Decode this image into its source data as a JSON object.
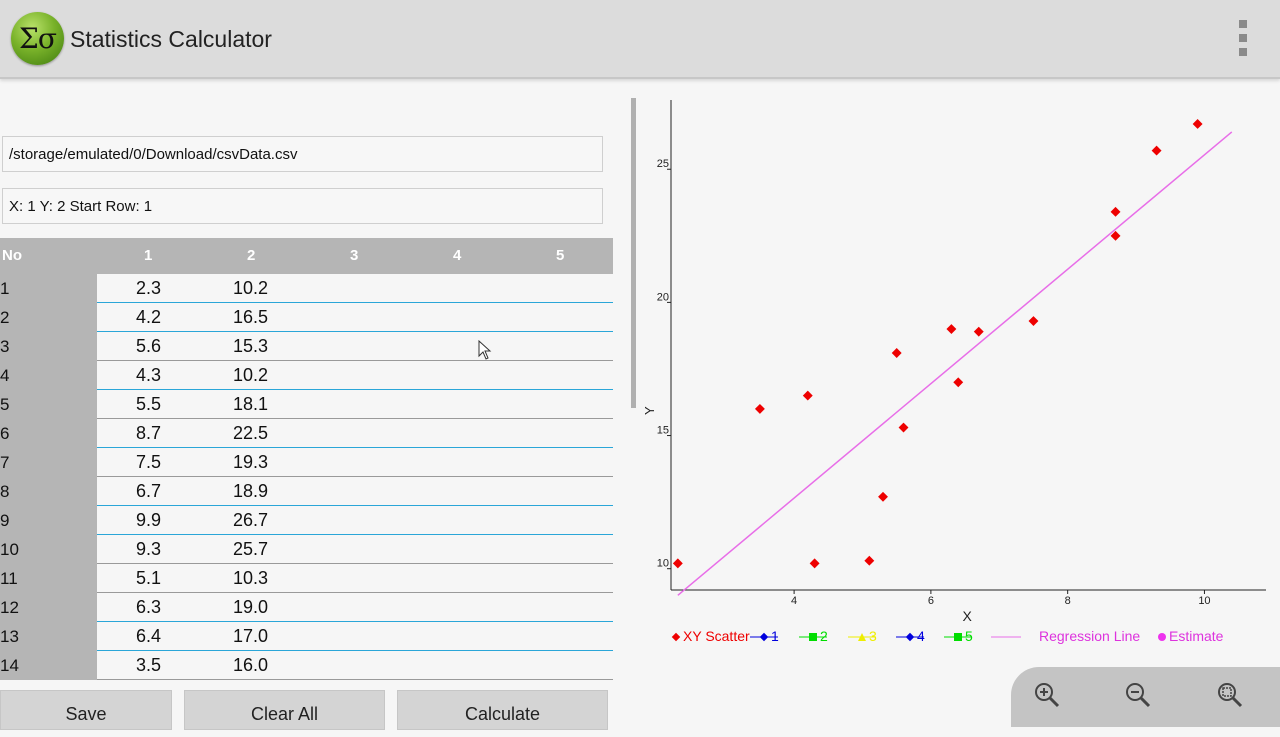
{
  "app": {
    "logo_text": "Σσ",
    "title": "Statistics Calculator"
  },
  "inputs": {
    "file_path": "/storage/emulated/0/Download/csvData.csv",
    "columns_config": "X: 1 Y: 2 Start Row: 1"
  },
  "table": {
    "headers": [
      "No",
      "1",
      "2",
      "3",
      "4",
      "5"
    ],
    "rows": [
      {
        "no": "1",
        "c1": "2.3",
        "c2": "10.2"
      },
      {
        "no": "2",
        "c1": "4.2",
        "c2": "16.5"
      },
      {
        "no": "3",
        "c1": "5.6",
        "c2": "15.3"
      },
      {
        "no": "4",
        "c1": "4.3",
        "c2": "10.2"
      },
      {
        "no": "5",
        "c1": "5.5",
        "c2": "18.1"
      },
      {
        "no": "6",
        "c1": "8.7",
        "c2": "22.5"
      },
      {
        "no": "7",
        "c1": "7.5",
        "c2": "19.3"
      },
      {
        "no": "8",
        "c1": "6.7",
        "c2": "18.9"
      },
      {
        "no": "9",
        "c1": "9.9",
        "c2": "26.7"
      },
      {
        "no": "10",
        "c1": "9.3",
        "c2": "25.7"
      },
      {
        "no": "11",
        "c1": "5.1",
        "c2": "10.3"
      },
      {
        "no": "12",
        "c1": "6.3",
        "c2": "19.0"
      },
      {
        "no": "13",
        "c1": "6.4",
        "c2": "17.0"
      },
      {
        "no": "14",
        "c1": "3.5",
        "c2": "16.0"
      }
    ]
  },
  "buttons": {
    "save": "Save",
    "clear": "Clear All",
    "calculate": "Calculate"
  },
  "zoom": {
    "zoom_in_icon": "zoom-in-icon",
    "zoom_out_icon": "zoom-out-icon",
    "zoom_reset_icon": "zoom-reset-icon"
  },
  "colors": {
    "scatter": "#ee0000",
    "regression": "#e86ee8",
    "legend_text": "#dd33dd",
    "series_1": "#0000dd",
    "series_2": "#00dd00",
    "series_3": "#eeee00",
    "series_4": "#0000dd",
    "series_5": "#00dd00",
    "estimate": "#ee33ee",
    "row_divider": "#2aa6d8"
  },
  "chart_data": {
    "type": "scatter",
    "xlabel": "X",
    "ylabel": "Y",
    "xlim": [
      2.2,
      10.9
    ],
    "ylim": [
      9.2,
      27.6
    ],
    "xticks": [
      4,
      6,
      8,
      10
    ],
    "yticks": [
      10,
      15,
      20,
      25
    ],
    "grid": false,
    "legend_placement": "bottom",
    "series": [
      {
        "name": "XY Scatter",
        "points": [
          [
            2.3,
            10.2
          ],
          [
            4.2,
            16.5
          ],
          [
            5.6,
            15.3
          ],
          [
            4.3,
            10.2
          ],
          [
            5.5,
            18.1
          ],
          [
            8.7,
            22.5
          ],
          [
            7.5,
            19.3
          ],
          [
            6.7,
            18.9
          ],
          [
            9.9,
            26.7
          ],
          [
            9.3,
            25.7
          ],
          [
            5.1,
            10.3
          ],
          [
            6.3,
            19.0
          ],
          [
            6.4,
            17.0
          ],
          [
            3.5,
            16.0
          ],
          [
            8.7,
            23.4
          ],
          [
            5.3,
            12.7
          ]
        ]
      }
    ],
    "regression_line": {
      "name": "Regression Line",
      "from": [
        2.3,
        9.0
      ],
      "to": [
        10.4,
        26.4
      ]
    },
    "legend": [
      "XY Scatter",
      "1",
      "2",
      "3",
      "4",
      "5",
      "Regression Line",
      "Estimate"
    ]
  }
}
